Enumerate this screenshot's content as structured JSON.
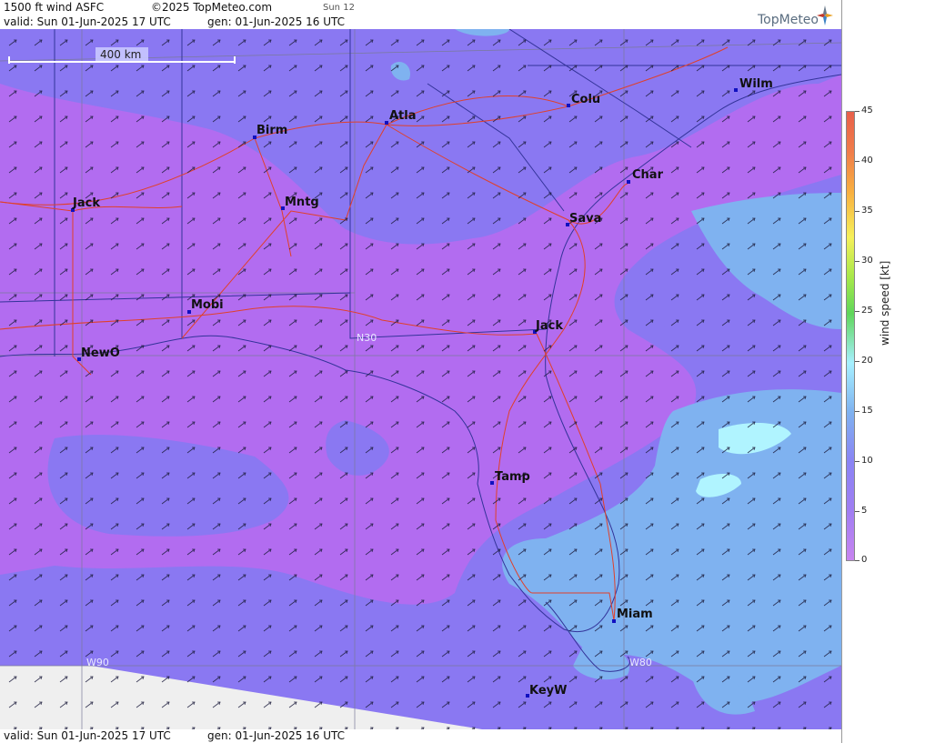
{
  "header": {
    "title": "1500 ft wind ASFC",
    "copyright": "©2025 TopMeteo.com",
    "day_code": "Sun 12",
    "valid": "valid:  Sun  01-Jun-2025  17 UTC",
    "gen": "gen: 01-Jun-2025 16 UTC",
    "brand": "TopMeteo"
  },
  "footer": {
    "valid": "valid:  Sun  01-Jun-2025  17 UTC",
    "gen": "gen: 01-Jun-2025 16 UTC"
  },
  "scale": {
    "label": "400 km"
  },
  "legend": {
    "label": "wind speed  [kt]",
    "ticks": [
      "45",
      "40",
      "35",
      "30",
      "25",
      "20",
      "15",
      "10",
      "5",
      "0"
    ]
  },
  "grid_labels": {
    "lat": "N30",
    "lon_west": "W90",
    "lon_east": "W80"
  },
  "cities": [
    {
      "name": "Wilm"
    },
    {
      "name": "Atla"
    },
    {
      "name": "Colu"
    },
    {
      "name": "Birm"
    },
    {
      "name": "Char"
    },
    {
      "name": "Jack"
    },
    {
      "name": "Mntg"
    },
    {
      "name": "Sava"
    },
    {
      "name": "Mobi"
    },
    {
      "name": "Jack"
    },
    {
      "name": "NewO"
    },
    {
      "name": "Tamp"
    },
    {
      "name": "Miam"
    },
    {
      "name": "KeyW"
    }
  ],
  "colors": {
    "calm": "#b26cf0",
    "light": "#8a78f2",
    "moderate": "#7fb2f0",
    "fresh": "#b0f4ff",
    "roads": "#e0402a",
    "borders": "#333399"
  }
}
